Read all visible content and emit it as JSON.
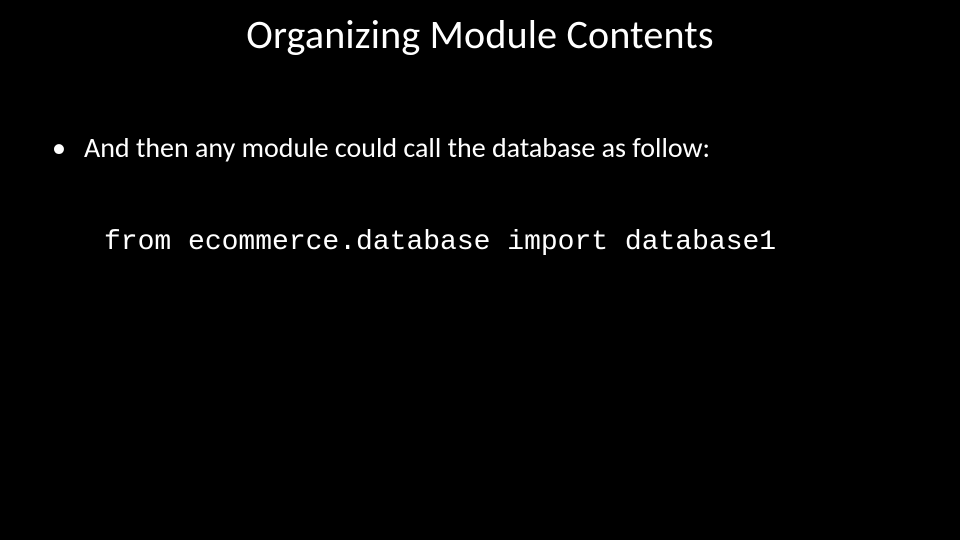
{
  "slide": {
    "title": "Organizing Module Contents",
    "bullets": [
      {
        "marker": "•",
        "text": "And then any module could call the database as follow:"
      }
    ],
    "code": "from ecommerce.database import database1"
  }
}
